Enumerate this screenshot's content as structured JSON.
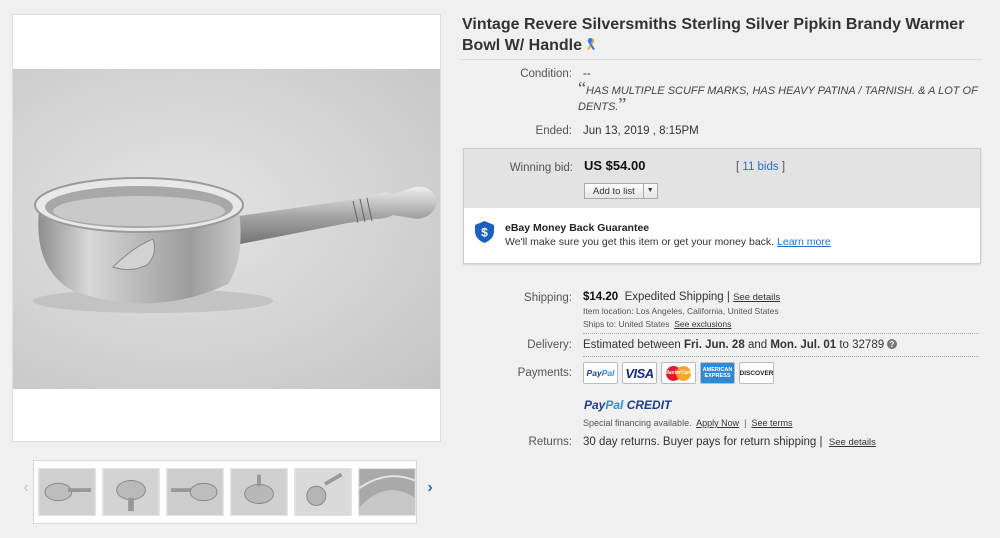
{
  "listing": {
    "title": "Vintage Revere Silversmiths Sterling Silver Pipkin Brandy Warmer Bowl W/ Handle",
    "ribbon_icon": "awareness-ribbon-icon"
  },
  "condition": {
    "label": "Condition:",
    "value": "--",
    "open_quote": "“",
    "close_quote": "”",
    "description": "HAS MULTIPLE SCUFF MARKS, HAS HEAVY PATINA / TARNISH. & A LOT OF DENTS."
  },
  "ended": {
    "label": "Ended:",
    "date": "Jun 13, 2019 ,",
    "time": "8:15PM"
  },
  "bid": {
    "label": "Winning bid:",
    "price": "US $54.00",
    "count_open": "[",
    "count": "11 bids",
    "count_close": "]",
    "add_to_list": "Add to list"
  },
  "guarantee": {
    "title": "eBay Money Back Guarantee",
    "text": "We'll make sure you get this item or get your money back.",
    "link": "Learn more"
  },
  "shipping": {
    "label": "Shipping:",
    "price": "$14.20",
    "method": "Expedited Shipping",
    "separator": "|",
    "details_link": "See details",
    "item_location_label": "Item location:",
    "item_location": "Los Angeles, California, United States",
    "ships_to_label": "Ships to:",
    "ships_to": "United States",
    "exclusions_link": "See exclusions"
  },
  "delivery": {
    "label": "Delivery:",
    "prefix": "Estimated between",
    "start": "Fri. Jun. 28",
    "and": "and",
    "end": "Mon. Jul. 01",
    "to": "to 32789"
  },
  "payments": {
    "label": "Payments:",
    "methods": [
      "PayPal",
      "VISA",
      "MasterCard",
      "AMERICAN EXPRESS",
      "DISCOVER"
    ],
    "paypal_logo": {
      "pay": "Pay",
      "pal": "Pal"
    },
    "credit_logo": {
      "pay": "Pay",
      "pal": "Pal",
      "credit": "CREDIT"
    },
    "financing_text": "Special financing available.",
    "apply_link": "Apply Now",
    "separator": "|",
    "terms_link": "See terms"
  },
  "returns": {
    "label": "Returns:",
    "text": "30 day returns. Buyer pays for return shipping |",
    "details_link": "See details"
  },
  "gallery": {
    "prev_arrow": "‹",
    "next_arrow": "›",
    "thumbnail_count": 6
  },
  "colors": {
    "link": "#2a6cc9",
    "bid_background": "#e3e3e3",
    "page_background": "#f0f0f0"
  }
}
